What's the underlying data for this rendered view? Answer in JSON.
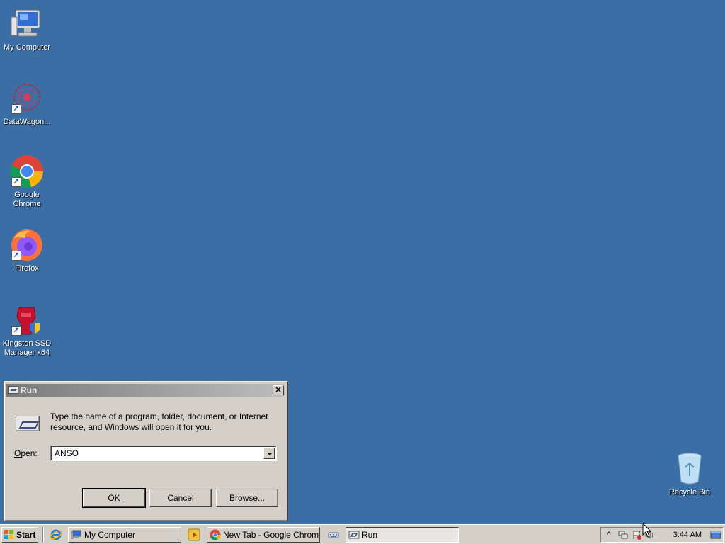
{
  "desktop": {
    "icons": [
      {
        "label": "My Computer"
      },
      {
        "label": "DataWagon..."
      },
      {
        "label": "Google Chrome"
      },
      {
        "label": "Firefox"
      },
      {
        "label": "Kingston SSD Manager x64"
      },
      {
        "label": "Recycle Bin"
      }
    ]
  },
  "run_dialog": {
    "title": "Run",
    "close_glyph": "✕",
    "prompt": "Type the name of a program, folder, document, or Internet resource, and Windows will open it for you.",
    "open_label_prefix": "",
    "open_label_u": "O",
    "open_label_rest": "pen:",
    "open_value": "ANSO",
    "ok_label": "OK",
    "cancel_label": "Cancel",
    "browse_label_u": "B",
    "browse_label_rest": "rowse..."
  },
  "taskbar": {
    "start_label": "Start",
    "tasks": [
      {
        "label": "My Computer"
      },
      {
        "label": "New Tab - Google Chrome"
      },
      {
        "label": "Run"
      }
    ],
    "clock": "3:44 AM"
  }
}
